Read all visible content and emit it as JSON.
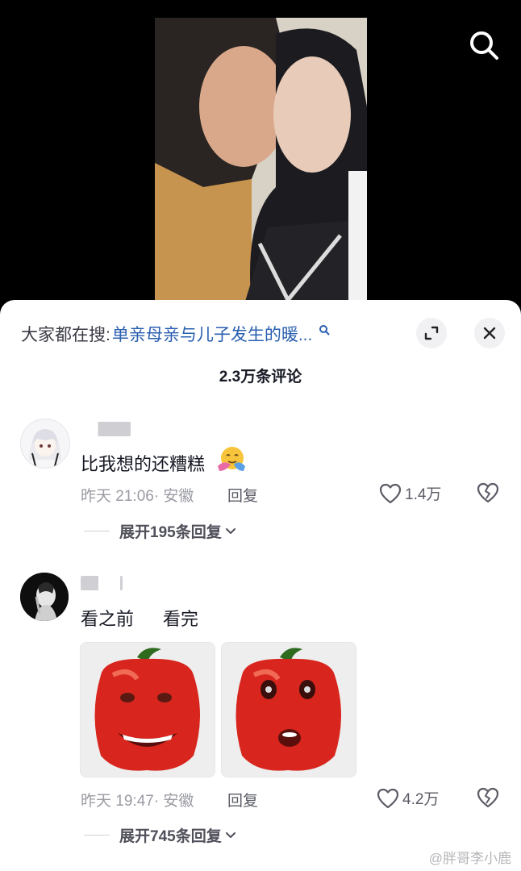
{
  "header": {
    "search_icon": "search-icon"
  },
  "hot_search": {
    "prefix": "大家都在搜:",
    "query": "单亲母亲与儿子发生的暖...",
    "icon": "search-icon"
  },
  "controls": {
    "expand_icon": "expand-icon",
    "close_icon": "close-icon"
  },
  "comments_header": {
    "count_text": "2.3万条评论"
  },
  "comments": [
    {
      "text": "比我想的还糟糕",
      "meta": "昨天 21:06· 安徽",
      "reply_label": "回复",
      "likes": "1.4万",
      "expand_label": "展开195条回复"
    },
    {
      "text_a": "看之前",
      "text_b": "看完",
      "meta": "昨天 19:47· 安徽",
      "reply_label": "回复",
      "likes": "4.2万",
      "expand_label": "展开745条回复"
    }
  ],
  "watermark": "@胖哥李小鹿",
  "colors": {
    "link": "#2a5fb0",
    "muted": "#9a9ba3",
    "sheet": "#ffffff"
  }
}
